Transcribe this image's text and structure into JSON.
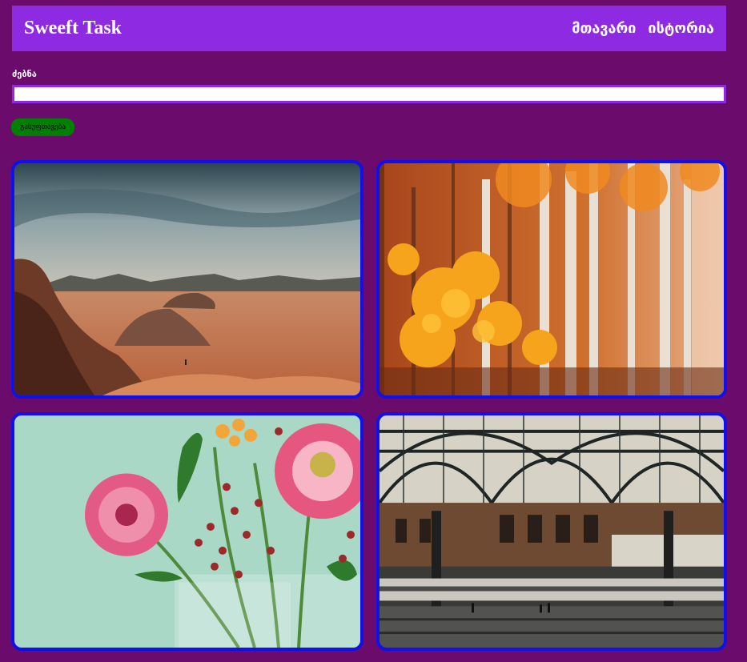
{
  "navbar": {
    "brand": "Sweeft Task",
    "links": [
      "მთავარი",
      "ისტორია"
    ]
  },
  "search": {
    "label": "ძებნა",
    "value": "",
    "placeholder": ""
  },
  "clear_button": "გასუფთავება",
  "colors": {
    "background": "#6b0b6b",
    "navbar": "#8e2be2",
    "card_border": "#1010ee",
    "button": "#008000"
  },
  "gallery": [
    {
      "subject": "desert-landscape-photo"
    },
    {
      "subject": "autumn-birch-forest-photo"
    },
    {
      "subject": "pink-gerbera-flowers-photo"
    },
    {
      "subject": "train-station-photo"
    }
  ]
}
